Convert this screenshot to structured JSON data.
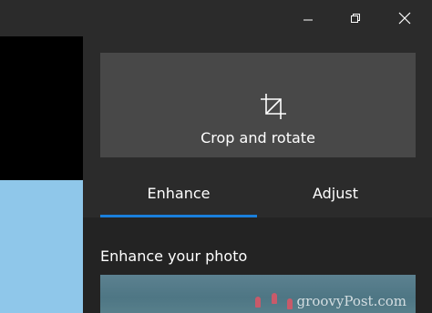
{
  "window_controls": {
    "minimize_icon": "minimize-icon",
    "maximize_icon": "restore-icon",
    "close_icon": "close-icon"
  },
  "editor_panel": {
    "crop_button": {
      "label": "Crop and rotate",
      "icon": "crop-icon"
    },
    "tabs": [
      {
        "label": "Enhance",
        "selected": true
      },
      {
        "label": "Adjust",
        "selected": false
      }
    ],
    "section_title": "Enhance your photo"
  },
  "watermark": "groovyPost.com",
  "colors": {
    "background": "#2b2b2b",
    "button_bg": "#484848",
    "accent": "#1a7fdb",
    "text": "#ffffff"
  }
}
